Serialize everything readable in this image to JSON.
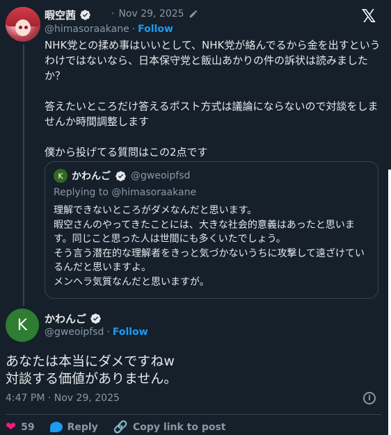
{
  "tweet1": {
    "name": "暇空茜",
    "date": "Nov 29, 2025",
    "handle": "@himasoraakane",
    "follow": "Follow",
    "paragraphs": [
      "NHK党との揉め事はいいとして、NHK党が絡んでるから金を出すというわけではないなら、日本保守党と飯山あかりの件の訴状は読みましたか？",
      "答えたいところだけ答えるポスト方式は議論にならないので対談をしませんか時間調整します",
      "僕から投げてる質問はこの2点です"
    ]
  },
  "quote": {
    "avatar_letter": "K",
    "name": "かわんご",
    "handle": "@gweoipfsd",
    "replying": "Replying to @himasoraakane",
    "lines": [
      "理解できないところがダメなんだと思います。",
      "暇空さんのやってきたことには、大きな社会的意義はあったと思います。同じこと思った人は世間にも多くいたでしょう。",
      "そう言う潜在的な理解者をきっと気づかないうちに攻撃して遠ざけているんだと思いますよ。",
      "メンヘラ気質なんだと思いますが。"
    ]
  },
  "tweet2": {
    "avatar_letter": "K",
    "name": "かわんご",
    "handle": "@gweoipfsd",
    "follow": "Follow",
    "lines": [
      "あなたは本当にダメですねw",
      "対談する価値がありません。"
    ],
    "timestamp": "4:47 PM · Nov 29, 2025"
  },
  "actions": {
    "likes": "59",
    "reply": "Reply",
    "copy_link": "Copy link to post"
  },
  "colors": {
    "background": "#15202b",
    "accent": "#1d9bf0",
    "like": "#f91880",
    "muted": "#8b98a5"
  }
}
